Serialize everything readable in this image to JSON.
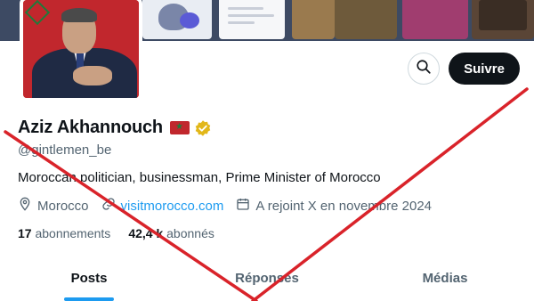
{
  "profile": {
    "name": "Aziz Akhannouch",
    "handle": "@gintlemen_be",
    "bio": "Moroccan politician, businessman, Prime Minister of Morocco",
    "location": "Morocco",
    "website": "visitmorocco.com",
    "joined": "A rejoint X en novembre 2024"
  },
  "stats": {
    "following_count": "17",
    "following_label": "abonnements",
    "followers_count": "42,4 k",
    "followers_label": "abonnés"
  },
  "actions": {
    "follow_label": "Suivre"
  },
  "tabs": [
    {
      "label": "Posts",
      "active": true
    },
    {
      "label": "Réponses",
      "active": false
    },
    {
      "label": "Médias",
      "active": false
    }
  ],
  "icons": {
    "search": "search-icon",
    "verified": "verified-badge-icon",
    "location": "location-pin-icon",
    "link": "link-icon",
    "calendar": "calendar-icon",
    "flag": "morocco-flag-icon"
  },
  "colors": {
    "accent": "#1d9bf0",
    "verified_gold": "#e2b719",
    "strike_red": "#d9232a",
    "follow_bg": "#0f1419"
  }
}
